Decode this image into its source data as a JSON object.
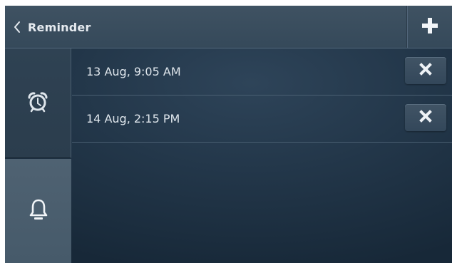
{
  "header": {
    "title": "Reminder",
    "back_icon": "chevron-left-icon",
    "add_icon": "plus-icon"
  },
  "sidebar": {
    "tabs": [
      {
        "icon": "alarm-clock-icon",
        "active": false
      },
      {
        "icon": "bell-icon",
        "active": true
      }
    ]
  },
  "reminders": [
    {
      "datetime": "13 Aug, 9:05 AM",
      "delete_icon": "close-icon"
    },
    {
      "datetime": "14 Aug, 2:15 PM",
      "delete_icon": "close-icon"
    }
  ],
  "colors": {
    "text": "#dfe6ec",
    "header_bg": "#3f5262",
    "active_tab_bg": "#4f6272",
    "screen_bg": "#23374a"
  }
}
